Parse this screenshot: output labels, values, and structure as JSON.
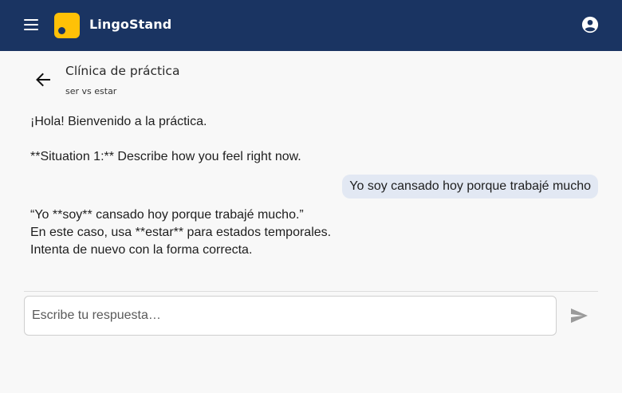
{
  "header": {
    "app_name": "LingoStand",
    "menu_icon": "hamburger-menu-icon",
    "account_icon": "account-circle-icon",
    "background_color": "#1a3462",
    "logo_color": "#ffc107"
  },
  "page": {
    "back_icon": "arrow-left-icon",
    "title": "Clínica de práctica",
    "subtitle": "ser vs estar"
  },
  "conversation": {
    "bot_greeting": "¡Hola! Bienvenido a la práctica.",
    "bot_situation": "**Situation 1:** Describe how you feel right now.",
    "user_reply": "Yo soy cansado hoy porque trabajé mucho",
    "user_bubble_color": "#e2e8f3",
    "bot_feedback": [
      "“Yo **soy** cansado hoy porque trabajé mucho.”",
      "En este caso, usa **estar** para estados temporales.",
      "Intenta de nuevo con la forma correcta."
    ]
  },
  "composer": {
    "placeholder": "Escribe tu respuesta…",
    "value": "",
    "send_icon": "send-icon"
  }
}
